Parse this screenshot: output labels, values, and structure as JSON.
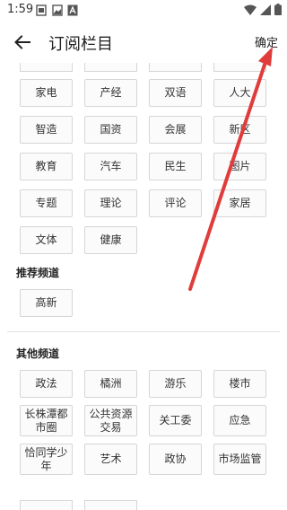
{
  "status_bar": {
    "time": "1:59",
    "icons": [
      "notification-icon",
      "image-icon",
      "font-icon",
      "wifi-icon",
      "signal-icon",
      "battery-icon"
    ]
  },
  "app_bar": {
    "title": "订阅栏目",
    "confirm_label": "确定"
  },
  "subscribed_tags": [
    "家电",
    "产经",
    "双语",
    "人大",
    "智造",
    "国资",
    "会展",
    "新区",
    "教育",
    "汽车",
    "民生",
    "图片",
    "专题",
    "理论",
    "评论",
    "家居",
    "文体",
    "健康"
  ],
  "recommended_section": {
    "title": "推荐频道",
    "tags": [
      "高新"
    ]
  },
  "other_section": {
    "title": "其他频道",
    "tags": [
      "政法",
      "橘洲",
      "游乐",
      "楼市",
      "长株潭都市圈",
      "公共资源交易",
      "关工委",
      "应急",
      "恰同学少年",
      "艺术",
      "政协",
      "市场监管"
    ]
  },
  "colors": {
    "background": "#ffffff",
    "tag_border": "#d6d6d6",
    "annotation_arrow": "#e03c3c"
  }
}
